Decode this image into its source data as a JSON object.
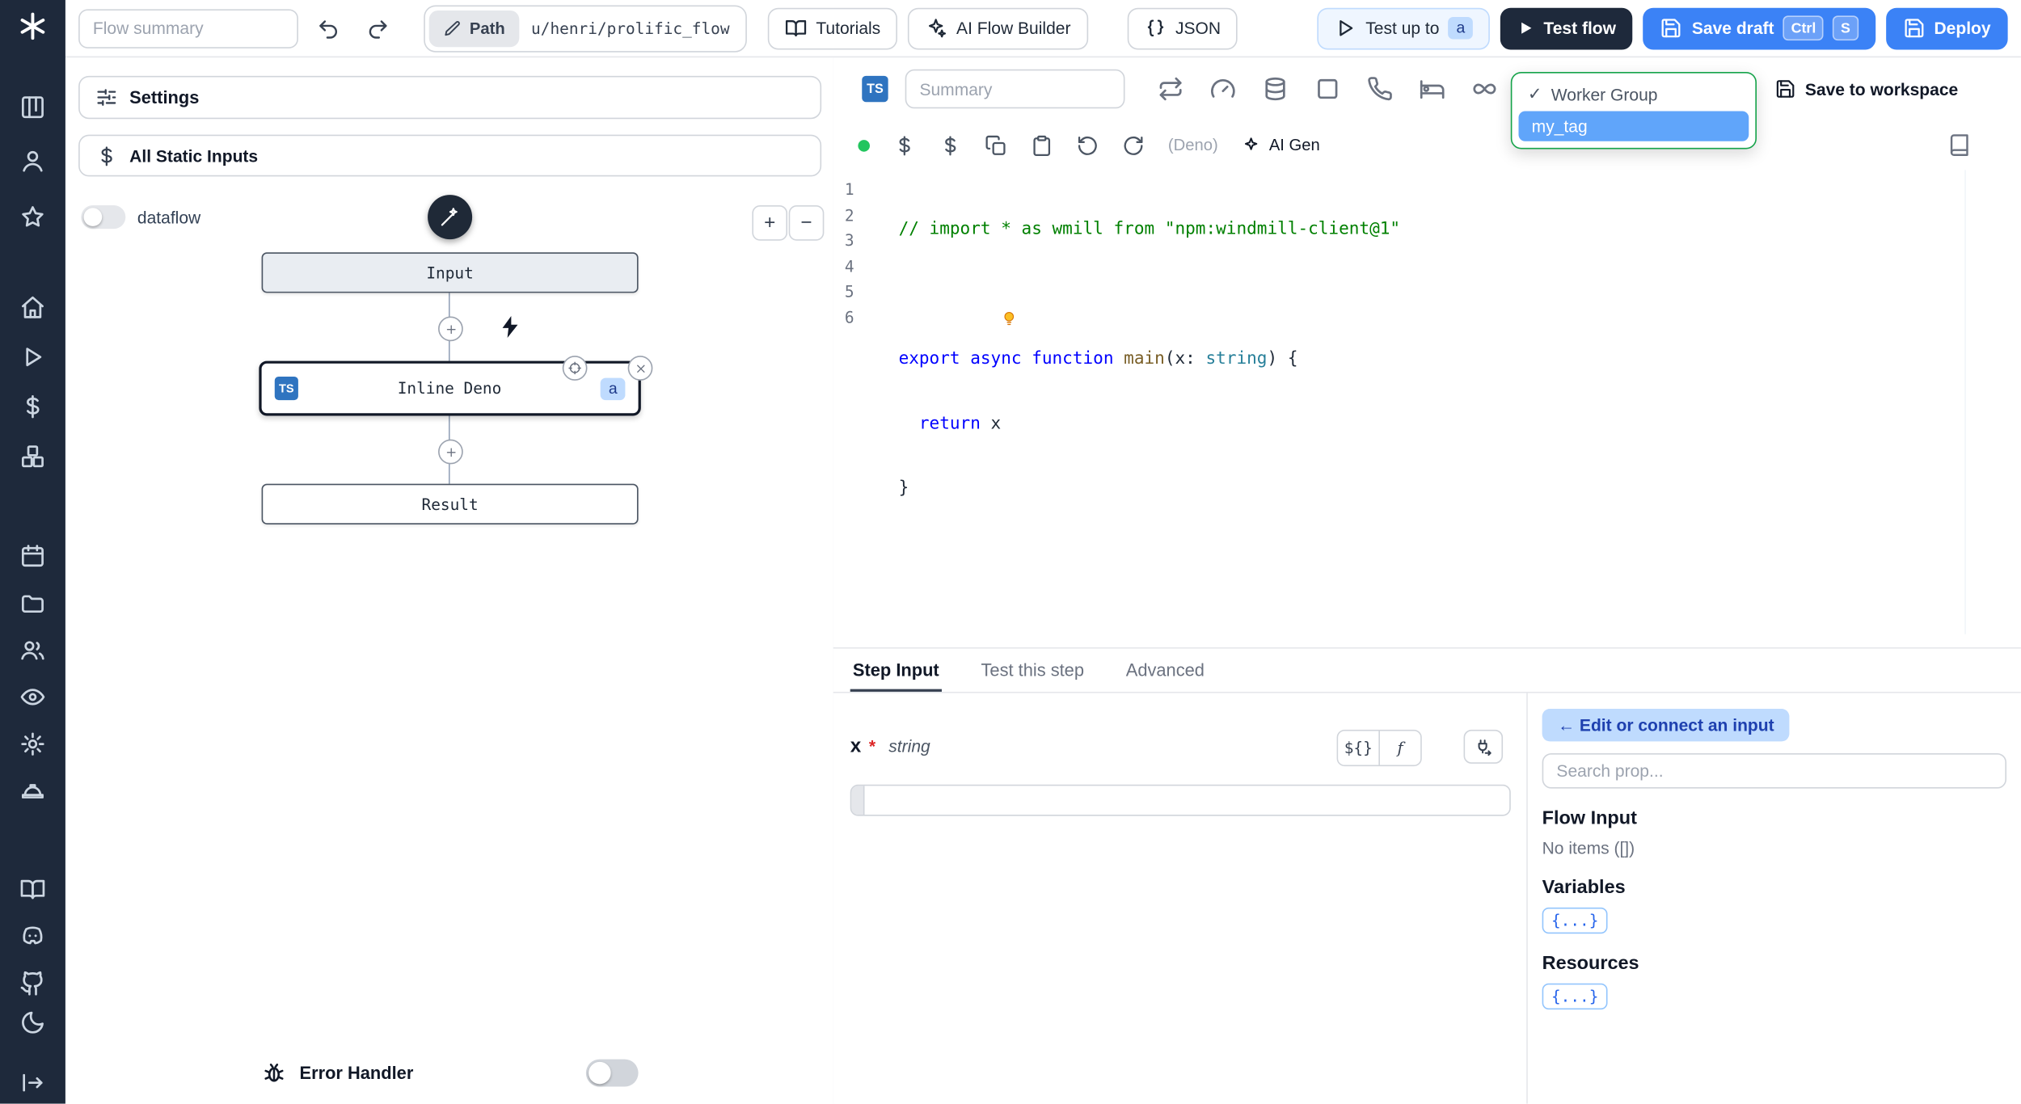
{
  "sidebar": {
    "icon_names": [
      "windmill-logo",
      "kanban",
      "user",
      "star",
      "home",
      "play",
      "dollar",
      "blocks",
      "calendar",
      "folder",
      "users",
      "eye",
      "gear",
      "worker",
      "book",
      "discord",
      "github",
      "moon",
      "collapse-arrow"
    ]
  },
  "topbar": {
    "flow_summary_placeholder": "Flow summary",
    "path_label": "Path",
    "path_value": "u/henri/prolific_flow",
    "tutorials": "Tutorials",
    "ai_flow_builder": "AI Flow Builder",
    "json": "JSON",
    "test_up_to": "Test up to",
    "test_up_to_badge": "a",
    "test_flow": "Test flow",
    "save_draft": "Save draft",
    "kbd_ctrl": "Ctrl",
    "kbd_s": "S",
    "deploy": "Deploy"
  },
  "flow_panel": {
    "settings": "Settings",
    "all_static_inputs": "All Static Inputs",
    "dataflow": "dataflow",
    "zoom_in": "+",
    "zoom_out": "−",
    "input_node": "Input",
    "deno_node": "Inline Deno",
    "deno_lang": "TS",
    "deno_badge": "a",
    "result_node": "Result",
    "error_handler": "Error Handler"
  },
  "editor": {
    "lang_badge": "TS",
    "summary_placeholder": "Summary",
    "dropdown_check": "✓",
    "dropdown_group": "Worker Group",
    "dropdown_tag": "my_tag",
    "save_to_workspace": "Save to workspace",
    "runtime": "(Deno)",
    "ai_gen": "AI Gen",
    "line_numbers": [
      "1",
      "2",
      "3",
      "4",
      "5",
      "6"
    ],
    "code": {
      "l1": "// import * as wmill from \"npm:windmill-client@1\"",
      "l3_kw": "export async function ",
      "l3_fn": "main",
      "l3_p1": "(x: ",
      "l3_type": "string",
      "l3_p2": ") {",
      "l4_kw": "  return",
      "l4_rest": " x",
      "l5": "}"
    }
  },
  "step_panel": {
    "tabs": [
      "Step Input",
      "Test this step",
      "Advanced"
    ],
    "arg_name": "x",
    "arg_required": "*",
    "arg_type": "string",
    "expr_button": "${}",
    "fn_button": "f",
    "picker": {
      "connect": "← Edit or connect an input",
      "search_placeholder": "Search prop...",
      "flow_input": "Flow Input",
      "no_items": "No items ([])",
      "variables": "Variables",
      "resources": "Resources",
      "braces": "{...}"
    }
  }
}
